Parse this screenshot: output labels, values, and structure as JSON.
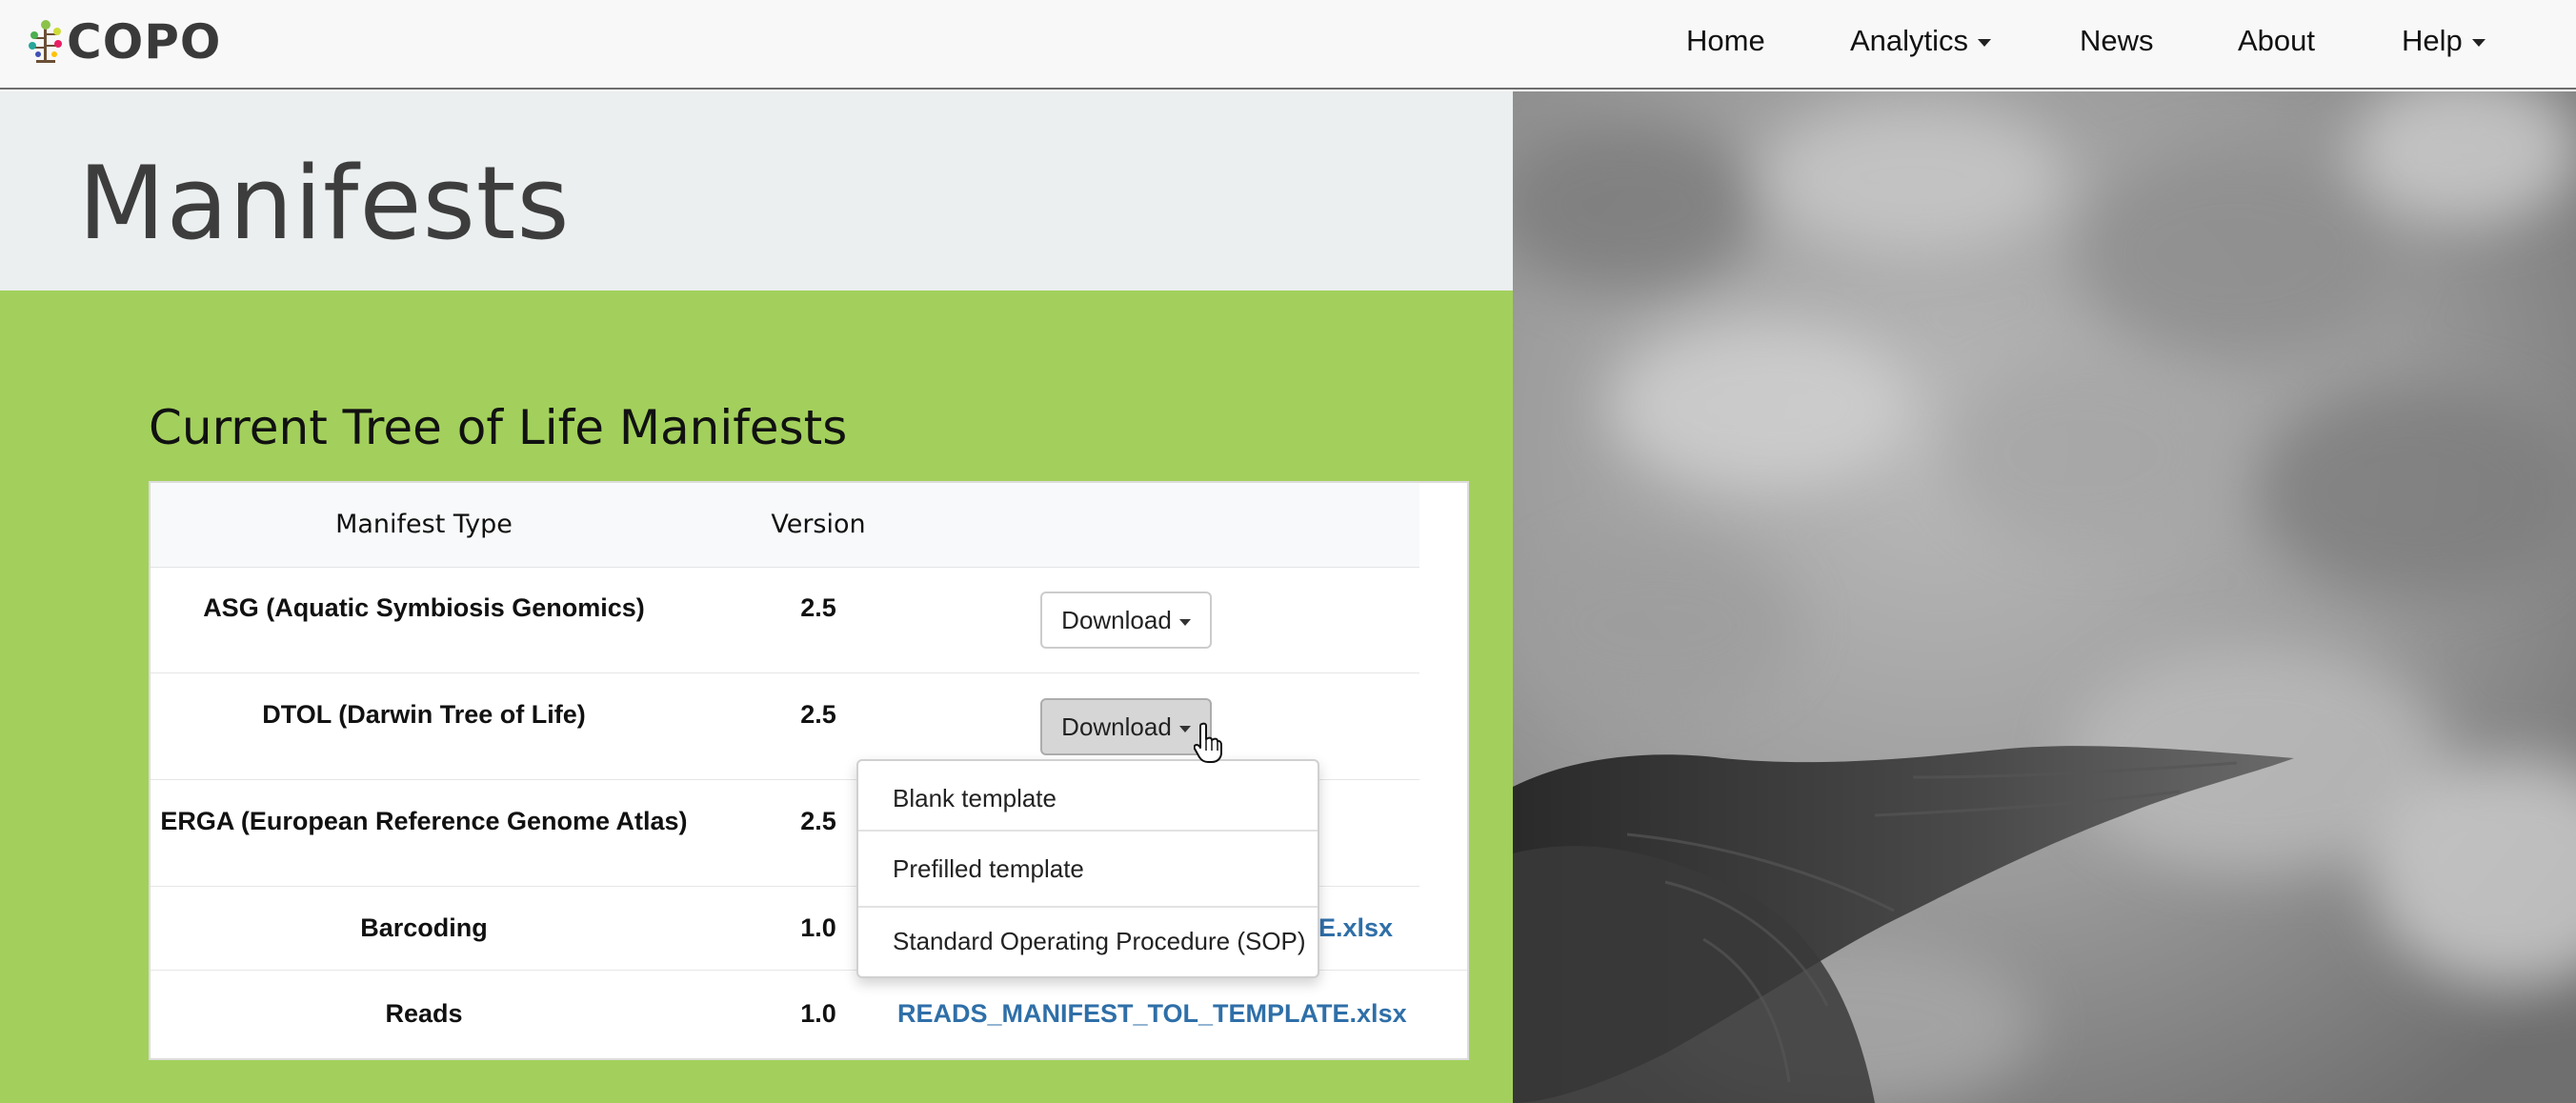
{
  "navbar": {
    "logo_text": "COPO",
    "items": [
      {
        "label": "Home",
        "has_dropdown": false
      },
      {
        "label": "Analytics",
        "has_dropdown": true
      },
      {
        "label": "News",
        "has_dropdown": false
      },
      {
        "label": "About",
        "has_dropdown": false
      },
      {
        "label": "Help",
        "has_dropdown": true
      }
    ]
  },
  "page": {
    "title": "Manifests",
    "section_title": "Current Tree of Life Manifests"
  },
  "table": {
    "headers": [
      "Manifest Type",
      "Version",
      ""
    ],
    "rows": [
      {
        "type": "ASG (Aquatic Symbiosis Genomics)",
        "version": "2.5",
        "action": "Download"
      },
      {
        "type": "DTOL (Darwin Tree of Life)",
        "version": "2.5",
        "action": "Download"
      },
      {
        "type": "ERGA (European Reference Genome Atlas)",
        "version": "2.5",
        "action": ""
      },
      {
        "type": "Barcoding",
        "version": "1.0",
        "link": "E.xlsx"
      },
      {
        "type": "Reads",
        "version": "1.0",
        "link": "READS_MANIFEST_TOL_TEMPLATE.xlsx"
      }
    ]
  },
  "dropdown": {
    "items": [
      "Blank template",
      "Prefilled template",
      "Standard Operating Procedure (SOP)"
    ]
  },
  "colors": {
    "green_background": "#a3d05c",
    "hero_background": "#ebefef",
    "link": "#2f6fa8"
  },
  "icons": [
    "copo-tree-logo-icon",
    "caret-down-icon",
    "hand-pointer-cursor-icon"
  ]
}
